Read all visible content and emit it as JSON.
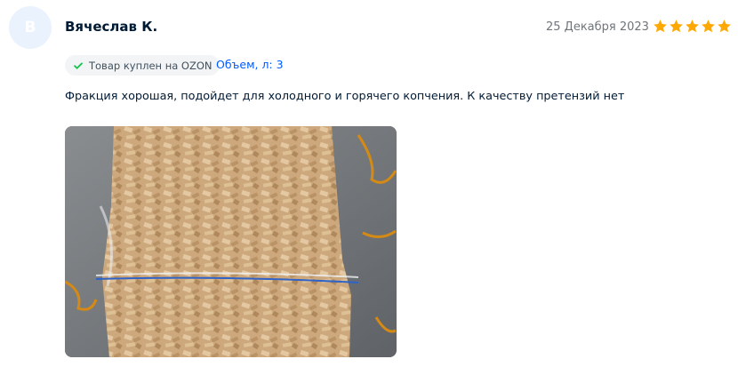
{
  "review": {
    "avatar_letter": "В",
    "author": "Вячеслав К.",
    "date": "25 Декабря 2023",
    "rating": 5,
    "purchase_badge": "Товар куплен на OZON",
    "variant": "Объем, л: 3",
    "text": "Фракция хорошая, подойдет для холодного и горячего копчения. К качеству претензий нет"
  },
  "colors": {
    "star": "#ffa800",
    "badge_check": "#10c44c",
    "link": "#005bff"
  },
  "icons": {
    "rating": "star-icon",
    "badge": "check-icon"
  }
}
